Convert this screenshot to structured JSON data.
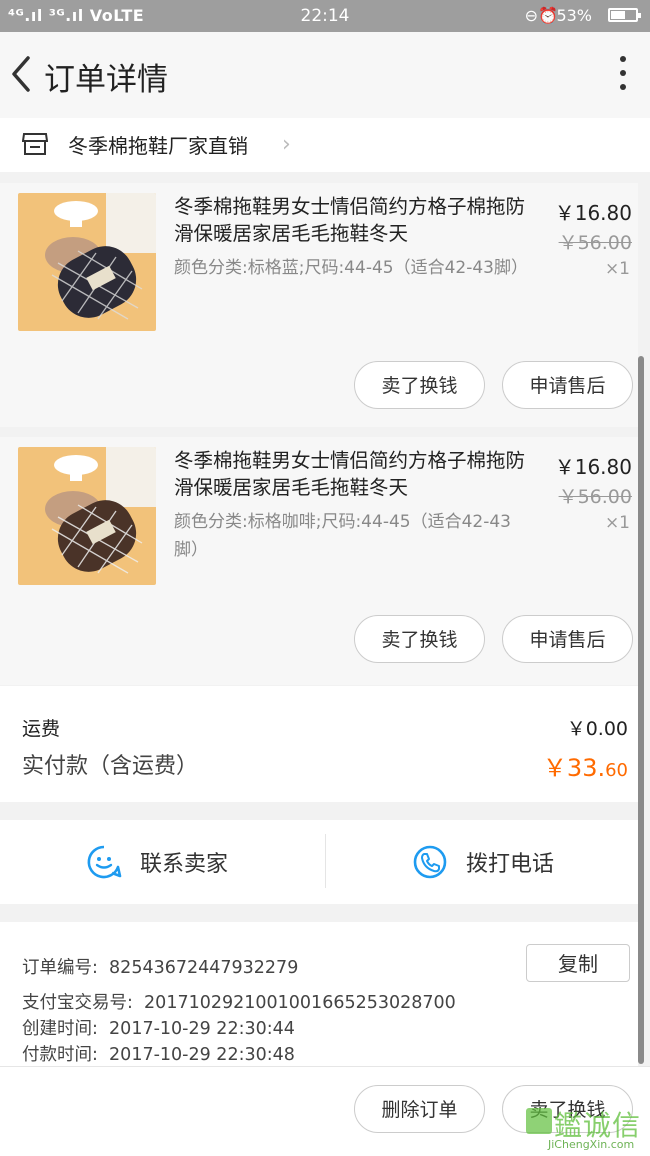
{
  "status_bar": {
    "network": "⁴ᴳ.ıl ³ᴳ.ıl VoLTE",
    "time": "22:14",
    "battery": "53%",
    "battery_level": 0.53
  },
  "nav": {
    "title": "订单详情"
  },
  "shop": {
    "name": "冬季棉拖鞋厂家直销"
  },
  "items": [
    {
      "title": "冬季棉拖鞋男女士情侣简约方格子棉拖防滑保暖居家居毛毛拖鞋冬天",
      "sku": "颜色分类:标格蓝;尺码:44-45（适合42-43脚）",
      "price": "￥16.80",
      "original_price": "￥56.00",
      "qty": "×1",
      "color": "#2c2b36",
      "buttons": {
        "sell": "卖了换钱",
        "after_sale": "申请售后"
      }
    },
    {
      "title": "冬季棉拖鞋男女士情侣简约方格子棉拖防滑保暖居家居毛毛拖鞋冬天",
      "sku": "颜色分类:标格咖啡;尺码:44-45（适合42-43脚）",
      "price": "￥16.80",
      "original_price": "￥56.00",
      "qty": "×1",
      "color": "#4a3328",
      "buttons": {
        "sell": "卖了换钱",
        "after_sale": "申请售后"
      }
    }
  ],
  "totals": {
    "shipping_label": "运费",
    "shipping_value": "￥0.00",
    "paid_label": "实付款（含运费）",
    "paid_main": "￥33.",
    "paid_cents": "60",
    "accent": "#ff6a00"
  },
  "contact": {
    "seller_label": "联系卖家",
    "phone_label": "拨打电话",
    "icon_color": "#1e9bf0"
  },
  "order_info": {
    "order_no_label": "订单编号:",
    "order_no": "82543672447932279",
    "copy_label": "复制",
    "alipay_label": "支付宝交易号:",
    "alipay_no": "2017102921001001665253028700",
    "created_label": "创建时间:",
    "created": "2017-10-29 22:30:44",
    "paid_time_label": "付款时间:",
    "paid_time": "2017-10-29 22:30:48"
  },
  "bottom_bar": {
    "delete_label": "删除订单",
    "sell_label": "卖了换钱"
  },
  "watermark": {
    "text": "鑑诚信",
    "url": "JiChengXin.com"
  }
}
